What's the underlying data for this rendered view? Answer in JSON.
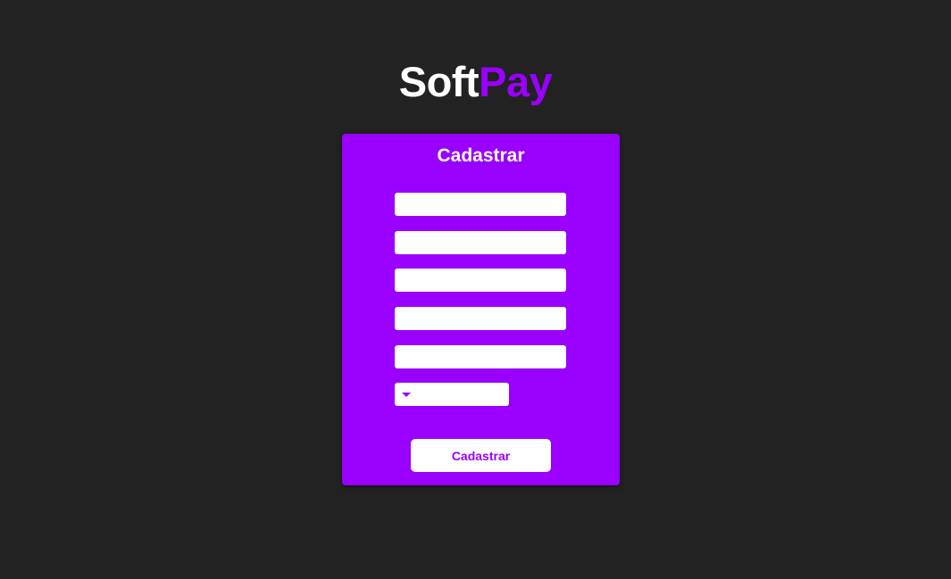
{
  "brand": {
    "part1": "Soft",
    "part2": "Pay",
    "accent_color": "#9900ff"
  },
  "form": {
    "title": "Cadastrar",
    "fields": [
      {
        "value": "",
        "placeholder": ""
      },
      {
        "value": "",
        "placeholder": ""
      },
      {
        "value": "",
        "placeholder": ""
      },
      {
        "value": "",
        "placeholder": ""
      },
      {
        "value": "",
        "placeholder": ""
      }
    ],
    "select": {
      "selected": "",
      "icon": "caret-down-icon"
    },
    "submit_label": "Cadastrar"
  }
}
